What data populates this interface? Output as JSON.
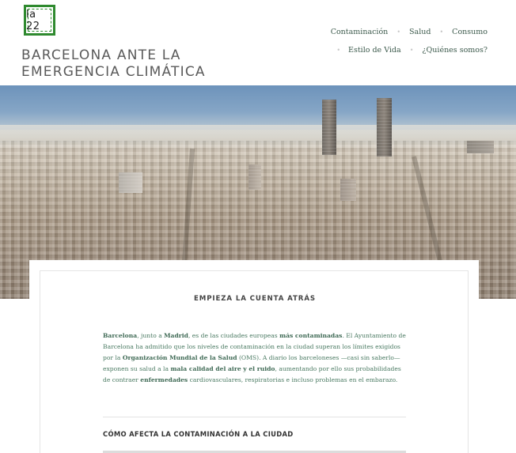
{
  "header": {
    "logo_text": "la 22",
    "site_title_line1": "BARCELONA ANTE LA",
    "site_title_line2": "EMERGENCIA CLIMÁTICA"
  },
  "nav": {
    "row1": [
      "Contaminación",
      "Salud",
      "Consumo"
    ],
    "row2": [
      "Estilo de Vida",
      "¿Quiénes somos?"
    ],
    "separator": "•"
  },
  "article": {
    "heading": "EMPIEZA LA CUENTA ATRÁS",
    "paragraph": [
      {
        "text": "Barcelona",
        "bold": true
      },
      {
        "text": ", junto a ",
        "bold": false
      },
      {
        "text": "Madrid",
        "bold": true
      },
      {
        "text": ", es de las ciudades europeas ",
        "bold": false
      },
      {
        "text": "más contaminadas",
        "bold": true
      },
      {
        "text": ". El Ayuntamiento de Barcelona ha admitido que los niveles de contaminación en la ciudad superan los límites exigidos por la ",
        "bold": false
      },
      {
        "text": "Organización Mundial de la Salud",
        "bold": true
      },
      {
        "text": " (OMS). A diario los barceloneses —casi sin saberlo—  exponen su salud a la ",
        "bold": false
      },
      {
        "text": "mala calidad del aire y el ruido",
        "bold": true
      },
      {
        "text": ", aumentando por ello sus probabilidades de contraer ",
        "bold": false
      },
      {
        "text": "enfermedades",
        "bold": true
      },
      {
        "text": " cardiovasculares, respiratorias e incluso problemas en el embarazo.",
        "bold": false
      }
    ],
    "subheading": "CÓMO AFECTA LA CONTAMINACIÓN A LA CIUDAD"
  },
  "colors": {
    "logo_green": "#2f8a2f",
    "link_green": "#4a7a62",
    "nav_text": "#3c5a4c"
  }
}
